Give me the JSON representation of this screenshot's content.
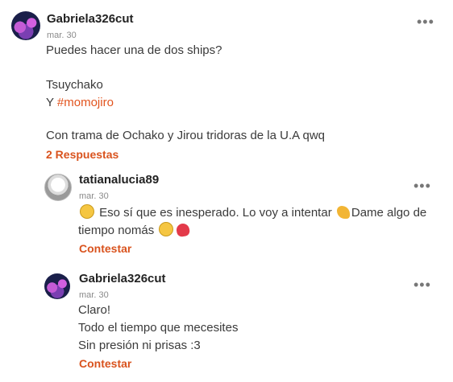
{
  "main_comment": {
    "username": "Gabriela326cut",
    "date": "mar. 30",
    "line1": "Puedes hacer una de dos ships?",
    "line2": "Tsuychako",
    "line3_prefix": "Y ",
    "line3_hashtag": "#momojiro",
    "line4": "Con trama de Ochako y Jirou tridoras de la U.A qwq",
    "replies_link": "2 Respuestas",
    "more_icon": "•••"
  },
  "replies": [
    {
      "username": "tatianalucia89",
      "date": "mar. 30",
      "text_part1": "Eso sí que es inesperado. Lo voy a intentar",
      "text_part2": "Dame algo de",
      "text_line2": "tiempo nomás",
      "reply_label": "Contestar",
      "more_icon": "•••",
      "emoji_names": [
        "face-screaming-icon",
        "flexed-biceps-icon",
        "grinning-face-icon",
        "heart-icon"
      ]
    },
    {
      "username": "Gabriela326cut",
      "date": "mar. 30",
      "line1": "Claro!",
      "line2": "Todo el tiempo que mecesites",
      "line3": "Sin presión ni prisas :3",
      "reply_label": "Contestar",
      "more_icon": "•••"
    }
  ]
}
